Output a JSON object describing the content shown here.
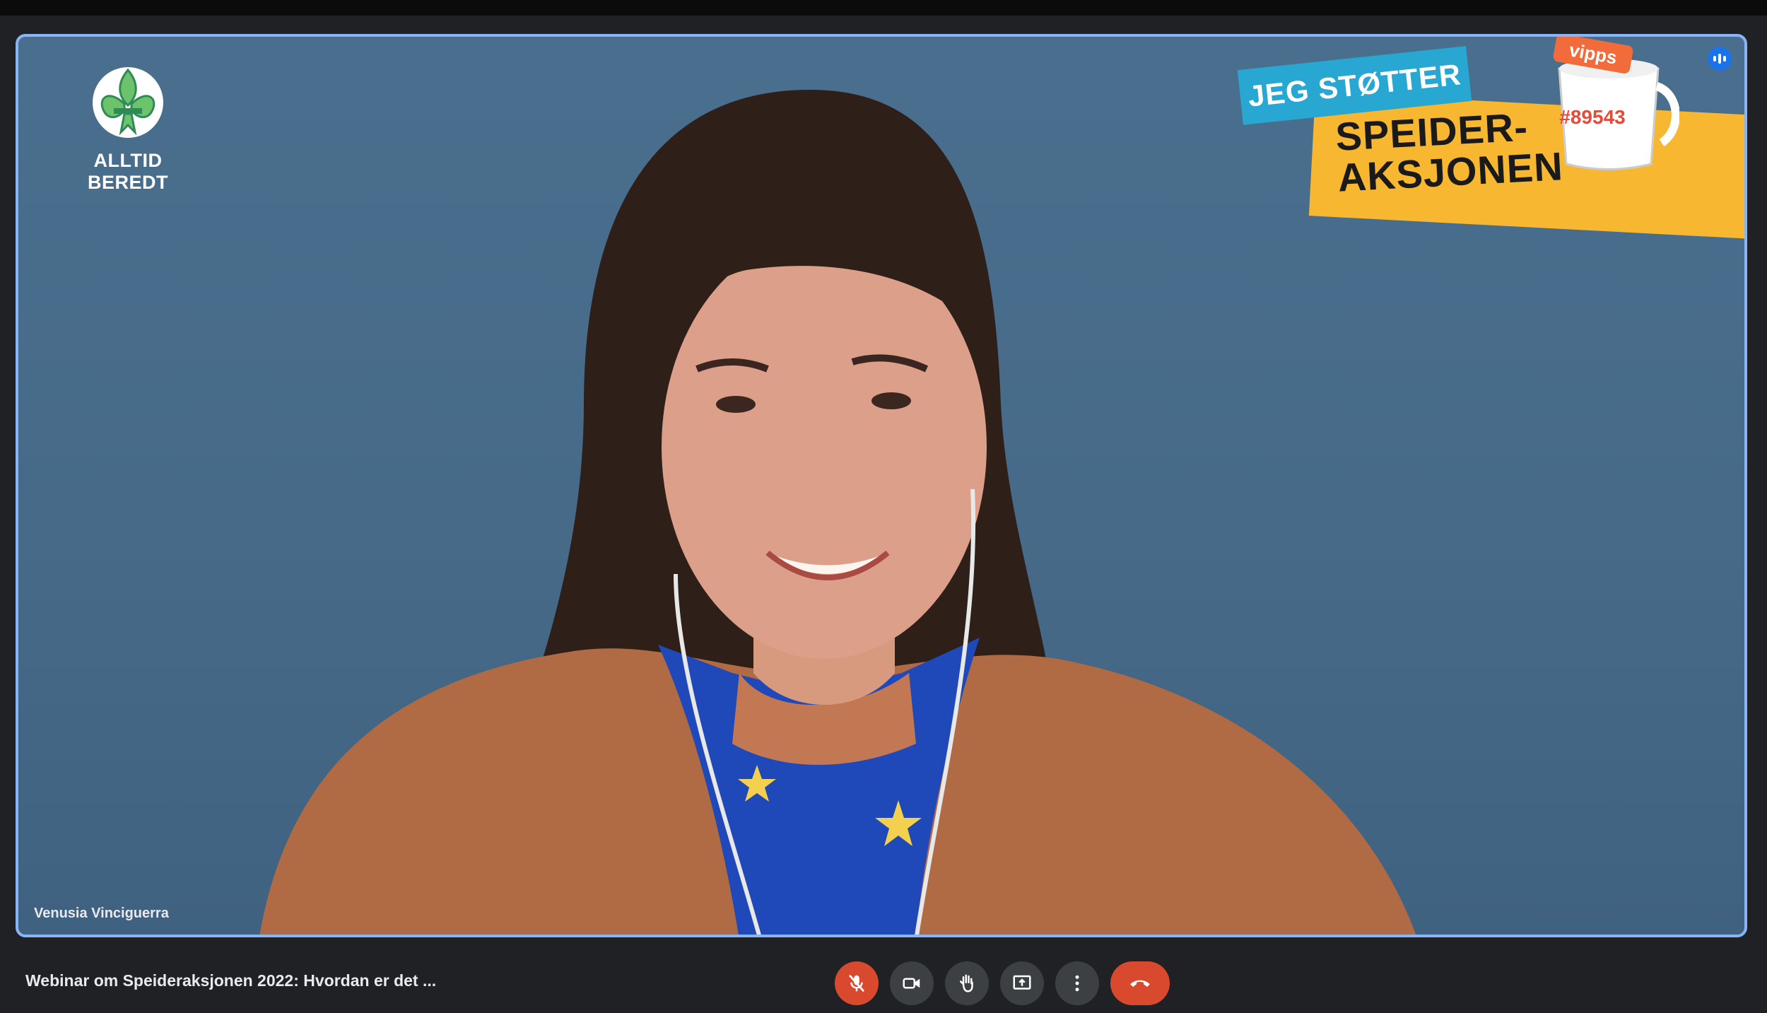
{
  "participant": {
    "name": "Venusia Vinciguerra"
  },
  "overlay": {
    "logo_text": "ALLTID BEREDT",
    "badge_support": "JEG STØTTER",
    "badge_title_line1": "SPEIDER-",
    "badge_title_line2": "AKSJONEN",
    "badge_code": "#89543",
    "badge_vipps": "vipps"
  },
  "meeting": {
    "title": "Webinar om Speideraksjonen 2022: Hvordan er det ..."
  },
  "controls": [
    {
      "icon": "mic-off-icon",
      "state": "muted"
    },
    {
      "icon": "camera-icon"
    },
    {
      "icon": "raise-hand-icon"
    },
    {
      "icon": "present-screen-icon"
    },
    {
      "icon": "more-options-icon"
    },
    {
      "icon": "end-call-icon"
    }
  ],
  "colors": {
    "accent_blue": "#8ab4f8",
    "end_call_red": "#d9492e",
    "badge_yellow": "#f7b731",
    "badge_blue": "#27a7d1"
  }
}
